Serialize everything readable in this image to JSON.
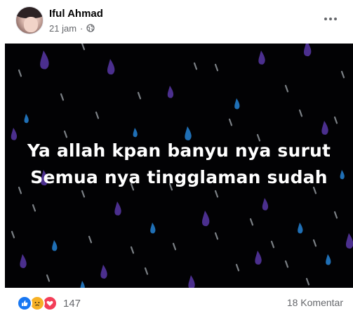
{
  "post": {
    "author_name": "Iful Ahmad",
    "timestamp": "21 jam",
    "separator": "·",
    "privacy_icon": "globe-icon",
    "image_text_line1": "Ya allah kpan banyu nya surut",
    "image_text_line2": "Semua nya tingglaman sudah",
    "reaction_icons": [
      "like-icon",
      "sad-icon",
      "love-icon"
    ],
    "reaction_count": "147",
    "comment_count": "18 Komentar"
  },
  "colors": {
    "image_background": "#020204",
    "raindrop_purple": "#4b2f8e",
    "raindrop_blue": "#1f6fb5",
    "raindrop_gray": "#9aa0a6",
    "like": "#1877f2",
    "sad": "#f7b125",
    "love": "#f33e58"
  }
}
